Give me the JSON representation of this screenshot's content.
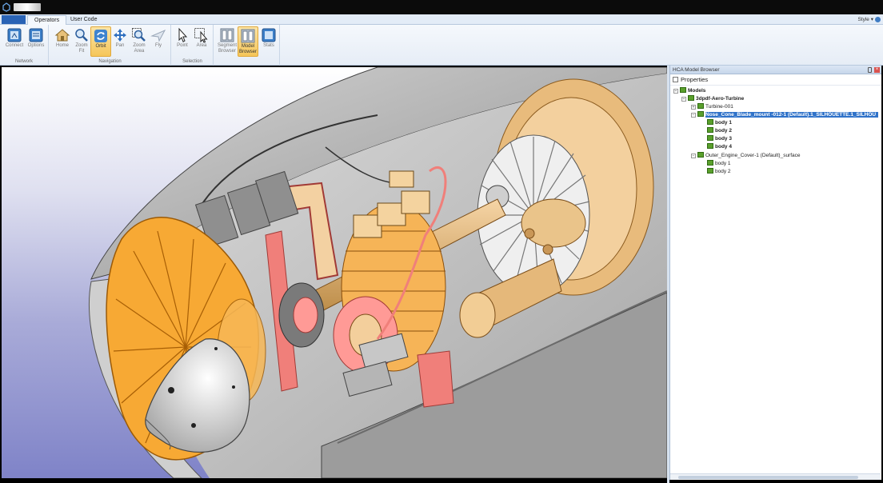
{
  "window": {
    "file_tab_label": "",
    "style_menu": "Style"
  },
  "tabs": [
    {
      "label": "Operators",
      "active": true
    },
    {
      "label": "User Code",
      "active": false
    }
  ],
  "ribbon": {
    "groups": [
      {
        "name": "Network",
        "buttons": [
          {
            "label": "Connect",
            "icon": "connect-icon"
          },
          {
            "label": "Options",
            "icon": "options-icon"
          }
        ]
      },
      {
        "name": "Navigation",
        "buttons": [
          {
            "label": "Home",
            "icon": "home-icon"
          },
          {
            "label": "Zoom\nFit",
            "icon": "zoom-fit-icon"
          },
          {
            "label": "Orbit",
            "icon": "orbit-icon",
            "active": true
          },
          {
            "label": "Pan",
            "icon": "pan-icon"
          },
          {
            "label": "Zoom\nArea",
            "icon": "zoom-area-icon"
          },
          {
            "label": "Fly",
            "icon": "fly-icon"
          }
        ]
      },
      {
        "name": "Selection",
        "buttons": [
          {
            "label": "Point",
            "icon": "pointer-icon"
          },
          {
            "label": "Area",
            "icon": "area-select-icon"
          }
        ]
      },
      {
        "name": "",
        "buttons": [
          {
            "label": "Segment\nBrowser",
            "icon": "segment-browser-icon"
          },
          {
            "label": "Model\nBrowser",
            "icon": "model-browser-icon",
            "active": true
          },
          {
            "label": "Stats",
            "icon": "stats-icon"
          }
        ]
      }
    ]
  },
  "browser": {
    "title": "HCA Model Browser",
    "properties_label": "Properties",
    "tree": [
      {
        "label": "Models",
        "level": 0,
        "expander": "-",
        "bold": true
      },
      {
        "label": "3dpdf-Aero-Turbine",
        "level": 1,
        "expander": "-",
        "bold": true
      },
      {
        "label": "Turbine-001",
        "level": 2,
        "expander": "+"
      },
      {
        "label": "Nose_Cone_Blade_mount -012-1 (Default).1_SILHOUETTE.1_SILHOU",
        "level": 2,
        "expander": "-",
        "selected": true
      },
      {
        "label": "body 1",
        "level": 3,
        "bold": true
      },
      {
        "label": "body 2",
        "level": 3,
        "bold": true
      },
      {
        "label": "body 3",
        "level": 3,
        "bold": true
      },
      {
        "label": "body 4",
        "level": 3,
        "bold": true
      },
      {
        "label": "Outer_Engine_Cover-1 (Default)_surface",
        "level": 2,
        "expander": "-"
      },
      {
        "label": "body 1",
        "level": 3
      },
      {
        "label": "body 2",
        "level": 3
      }
    ]
  },
  "colors": {
    "accent": "#2f72c9",
    "active_button": "#f5c65a",
    "viewport_bottom": "#7f83c8",
    "turbine_orange": "#f39a26",
    "engine_body": "#eecb9f",
    "shell_gray": "#b2b2b2"
  }
}
